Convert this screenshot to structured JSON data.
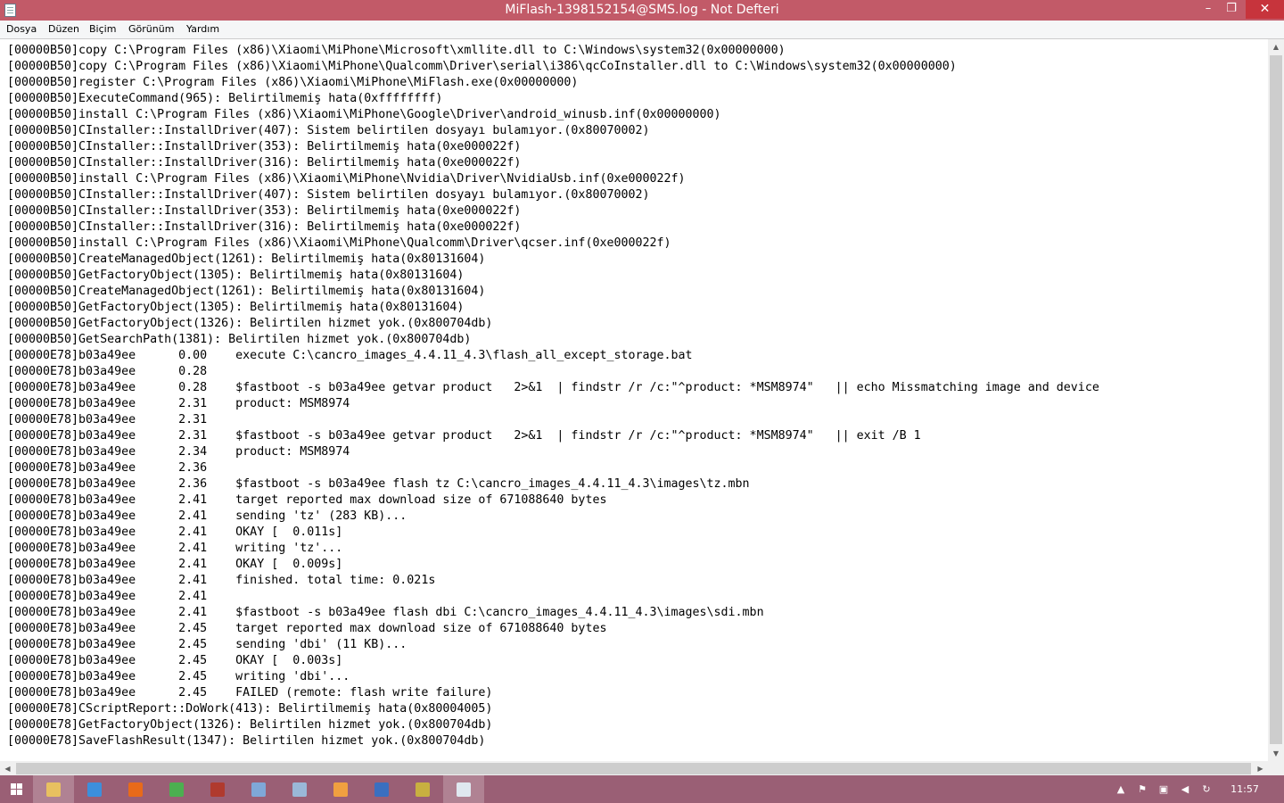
{
  "window": {
    "title": "MiFlash-1398152154@SMS.log - Not Defteri",
    "minimize_icon": "minimize-icon",
    "restore_icon": "restore-icon",
    "close_icon": "close-icon"
  },
  "menu": {
    "items": [
      "Dosya",
      "Düzen",
      "Biçim",
      "Görünüm",
      "Yardım"
    ]
  },
  "document": {
    "lines": [
      "[00000B50]copy C:\\Program Files (x86)\\Xiaomi\\MiPhone\\Microsoft\\xmllite.dll to C:\\Windows\\system32(0x00000000)",
      "[00000B50]copy C:\\Program Files (x86)\\Xiaomi\\MiPhone\\Qualcomm\\Driver\\serial\\i386\\qcCoInstaller.dll to C:\\Windows\\system32(0x00000000)",
      "[00000B50]register C:\\Program Files (x86)\\Xiaomi\\MiPhone\\MiFlash.exe(0x00000000)",
      "[00000B50]ExecuteCommand(965): Belirtilmemiş hata(0xffffffff)",
      "[00000B50]install C:\\Program Files (x86)\\Xiaomi\\MiPhone\\Google\\Driver\\android_winusb.inf(0x00000000)",
      "[00000B50]CInstaller::InstallDriver(407): Sistem belirtilen dosyayı bulamıyor.(0x80070002)",
      "[00000B50]CInstaller::InstallDriver(353): Belirtilmemiş hata(0xe000022f)",
      "[00000B50]CInstaller::InstallDriver(316): Belirtilmemiş hata(0xe000022f)",
      "[00000B50]install C:\\Program Files (x86)\\Xiaomi\\MiPhone\\Nvidia\\Driver\\NvidiaUsb.inf(0xe000022f)",
      "[00000B50]CInstaller::InstallDriver(407): Sistem belirtilen dosyayı bulamıyor.(0x80070002)",
      "[00000B50]CInstaller::InstallDriver(353): Belirtilmemiş hata(0xe000022f)",
      "[00000B50]CInstaller::InstallDriver(316): Belirtilmemiş hata(0xe000022f)",
      "[00000B50]install C:\\Program Files (x86)\\Xiaomi\\MiPhone\\Qualcomm\\Driver\\qcser.inf(0xe000022f)",
      "[00000B50]CreateManagedObject(1261): Belirtilmemiş hata(0x80131604)",
      "[00000B50]GetFactoryObject(1305): Belirtilmemiş hata(0x80131604)",
      "[00000B50]CreateManagedObject(1261): Belirtilmemiş hata(0x80131604)",
      "[00000B50]GetFactoryObject(1305): Belirtilmemiş hata(0x80131604)",
      "[00000B50]GetFactoryObject(1326): Belirtilen hizmet yok.(0x800704db)",
      "[00000B50]GetSearchPath(1381): Belirtilen hizmet yok.(0x800704db)",
      "[00000E78]b03a49ee      0.00    execute C:\\cancro_images_4.4.11_4.3\\flash_all_except_storage.bat",
      "[00000E78]b03a49ee      0.28",
      "[00000E78]b03a49ee      0.28    $fastboot -s b03a49ee getvar product   2>&1  | findstr /r /c:\"^product: *MSM8974\"   || echo Missmatching image and device",
      "[00000E78]b03a49ee      2.31    product: MSM8974",
      "[00000E78]b03a49ee      2.31",
      "[00000E78]b03a49ee      2.31    $fastboot -s b03a49ee getvar product   2>&1  | findstr /r /c:\"^product: *MSM8974\"   || exit /B 1",
      "[00000E78]b03a49ee      2.34    product: MSM8974",
      "[00000E78]b03a49ee      2.36",
      "[00000E78]b03a49ee      2.36    $fastboot -s b03a49ee flash tz C:\\cancro_images_4.4.11_4.3\\images\\tz.mbn",
      "[00000E78]b03a49ee      2.41    target reported max download size of 671088640 bytes",
      "[00000E78]b03a49ee      2.41    sending 'tz' (283 KB)...",
      "[00000E78]b03a49ee      2.41    OKAY [  0.011s]",
      "[00000E78]b03a49ee      2.41    writing 'tz'...",
      "[00000E78]b03a49ee      2.41    OKAY [  0.009s]",
      "[00000E78]b03a49ee      2.41    finished. total time: 0.021s",
      "[00000E78]b03a49ee      2.41",
      "[00000E78]b03a49ee      2.41    $fastboot -s b03a49ee flash dbi C:\\cancro_images_4.4.11_4.3\\images\\sdi.mbn",
      "[00000E78]b03a49ee      2.45    target reported max download size of 671088640 bytes",
      "[00000E78]b03a49ee      2.45    sending 'dbi' (11 KB)...",
      "[00000E78]b03a49ee      2.45    OKAY [  0.003s]",
      "[00000E78]b03a49ee      2.45    writing 'dbi'...",
      "[00000E78]b03a49ee      2.45    FAILED (remote: flash write failure)",
      "[00000E78]CScriptReport::DoWork(413): Belirtilmemiş hata(0x80004005)",
      "[00000E78]GetFactoryObject(1326): Belirtilen hizmet yok.(0x800704db)",
      "[00000E78]SaveFlashResult(1347): Belirtilen hizmet yok.(0x800704db)"
    ]
  },
  "taskbar": {
    "pinned": [
      {
        "name": "file-explorer-icon",
        "color": "#e8c060"
      },
      {
        "name": "internet-explorer-icon",
        "color": "#3c8fdc"
      },
      {
        "name": "firefox-icon",
        "color": "#e86a1a"
      },
      {
        "name": "chrome-icon",
        "color": "#4caf50"
      },
      {
        "name": "archive-app-icon",
        "color": "#b03a2e"
      },
      {
        "name": "network-app-icon",
        "color": "#7fa8d8"
      },
      {
        "name": "device-manager-icon",
        "color": "#9ab8d8"
      },
      {
        "name": "media-app-icon",
        "color": "#f0a040"
      },
      {
        "name": "sum-app-icon",
        "color": "#3a6fc0"
      },
      {
        "name": "game-app-icon",
        "color": "#c8b040"
      },
      {
        "name": "notepad-icon",
        "color": "#dfe8f0"
      }
    ],
    "clock": "11:57"
  }
}
